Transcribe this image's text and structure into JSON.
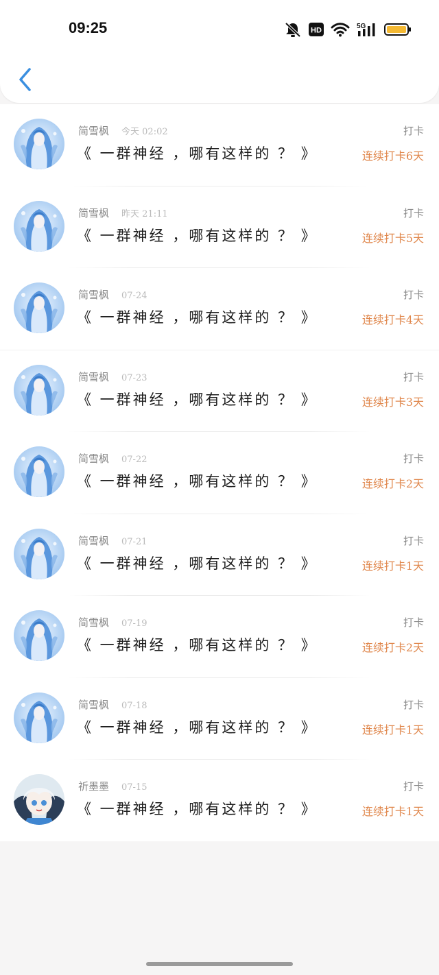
{
  "status_bar": {
    "time": "09:25",
    "icons": [
      "mute-bell-icon",
      "hd-icon",
      "wifi-icon",
      "5g-signal-icon",
      "battery-icon"
    ],
    "hd_label": "HD",
    "network_label": "5G",
    "battery_color": "#f4b933"
  },
  "header": {
    "back_icon": "chevron-left-icon",
    "accent": "#3a8fe0"
  },
  "colors": {
    "streak": "#e0874c",
    "muted": "#8a8a8a"
  },
  "items": [
    {
      "user": "简雪枫",
      "date": "今天 02:02",
      "title": "《 一群神经 ，哪有这样的 ？ 》",
      "tag": "打卡",
      "streak": "连续打卡6天",
      "avatar": "blue-haired-character-avatar"
    },
    {
      "user": "简雪枫",
      "date": "昨天 21:11",
      "title": "《 一群神经 ，哪有这样的 ？ 》",
      "tag": "打卡",
      "streak": "连续打卡5天",
      "avatar": "blue-haired-character-avatar"
    },
    {
      "user": "简雪枫",
      "date": "07-24",
      "title": "《 一群神经 ，哪有这样的 ？ 》",
      "tag": "打卡",
      "streak": "连续打卡4天",
      "avatar": "blue-haired-character-avatar"
    },
    {
      "user": "简雪枫",
      "date": "07-23",
      "title": "《 一群神经 ，哪有这样的 ？ 》",
      "tag": "打卡",
      "streak": "连续打卡3天",
      "avatar": "blue-haired-character-avatar"
    },
    {
      "user": "简雪枫",
      "date": "07-22",
      "title": "《 一群神经 ，哪有这样的 ？ 》",
      "tag": "打卡",
      "streak": "连续打卡2天",
      "avatar": "blue-haired-character-avatar"
    },
    {
      "user": "简雪枫",
      "date": "07-21",
      "title": "《 一群神经 ，哪有这样的 ？ 》",
      "tag": "打卡",
      "streak": "连续打卡1天",
      "avatar": "blue-haired-character-avatar"
    },
    {
      "user": "简雪枫",
      "date": "07-19",
      "title": "《 一群神经 ，哪有这样的 ？ 》",
      "tag": "打卡",
      "streak": "连续打卡2天",
      "avatar": "blue-haired-character-avatar"
    },
    {
      "user": "简雪枫",
      "date": "07-18",
      "title": "《 一群神经 ，哪有这样的 ？ 》",
      "tag": "打卡",
      "streak": "连续打卡1天",
      "avatar": "blue-haired-character-avatar"
    },
    {
      "user": "祈墨墨",
      "date": "07-15",
      "title": "《 一群神经 ，哪有这样的 ？ 》",
      "tag": "打卡",
      "streak": "连续打卡1天",
      "avatar": "white-haired-character-avatar"
    }
  ]
}
